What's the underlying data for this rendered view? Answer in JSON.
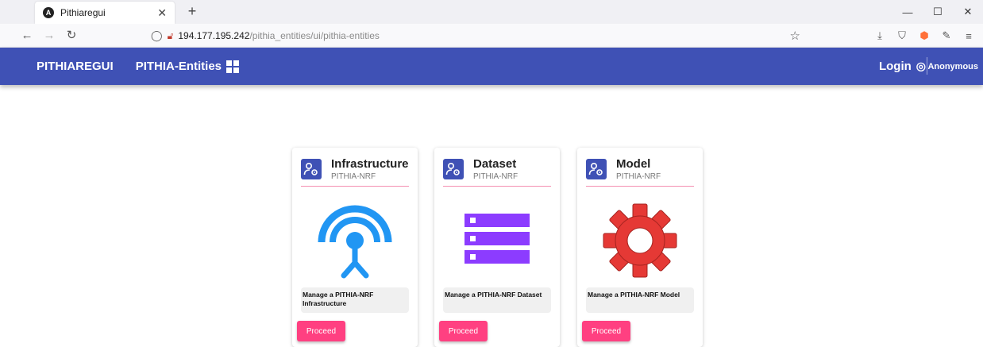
{
  "browser": {
    "tab_title": "Pithiaregui",
    "tab_favicon_glyph": "A",
    "url_host": "194.177.195.242",
    "url_path": "/pithia_entities/ui/pithia-entities"
  },
  "toolbar": {
    "brand": "PITHIAREGUI",
    "section": "PITHIA-Entities",
    "login": "Login",
    "user": "Anonymous",
    "color": "#3f51b5"
  },
  "cards": [
    {
      "title": "Infrastructure",
      "subtitle": "PITHIA-NRF",
      "description": "Manage a PITHIA-NRF Infrastructure",
      "button": "Proceed",
      "image": "antenna-icon"
    },
    {
      "title": "Dataset",
      "subtitle": "PITHIA-NRF",
      "description": "Manage a PITHIA-NRF Dataset",
      "button": "Proceed",
      "image": "server-stack-icon"
    },
    {
      "title": "Model",
      "subtitle": "PITHIA-NRF",
      "description": "Manage a PITHIA-NRF Model",
      "button": "Proceed",
      "image": "gear-icon"
    }
  ],
  "colors": {
    "accent": "#ff4081",
    "divider": "#f48fb1",
    "antenna": "#2196f3",
    "dataset": "#8c3cff",
    "gear": "#e53935"
  }
}
